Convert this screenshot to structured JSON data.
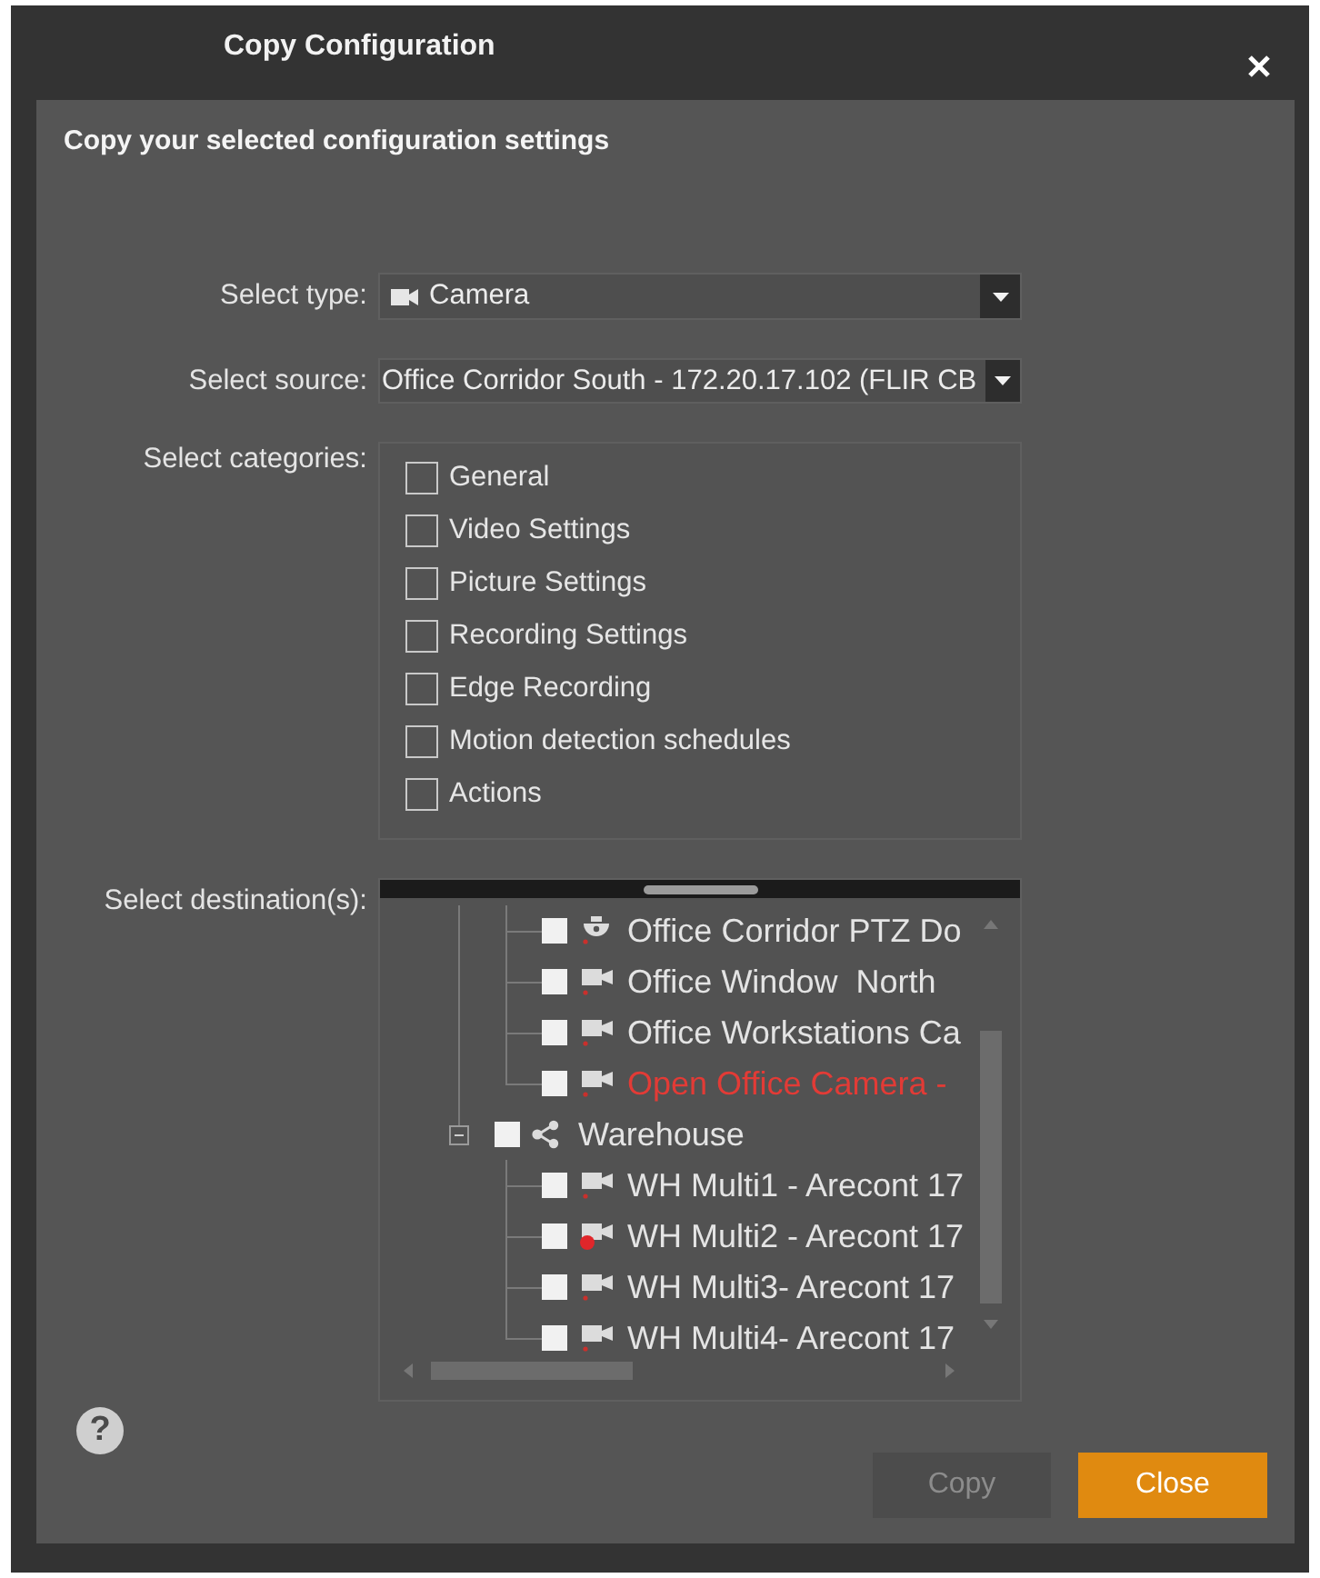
{
  "window": {
    "title": "Copy Configuration"
  },
  "heading": "Copy your selected configuration settings",
  "type_select": {
    "label": "Select type:",
    "value": "Camera"
  },
  "source_select": {
    "label": "Select source:",
    "value": "Office Corridor South - 172.20.17.102 (FLIR CB"
  },
  "categories": {
    "label": "Select categories:",
    "items": [
      {
        "label": "General",
        "checked": false
      },
      {
        "label": "Video Settings",
        "checked": false
      },
      {
        "label": "Picture Settings",
        "checked": false
      },
      {
        "label": "Recording Settings",
        "checked": false
      },
      {
        "label": "Edge Recording",
        "checked": false
      },
      {
        "label": "Motion detection schedules",
        "checked": false
      },
      {
        "label": "Actions",
        "checked": false
      }
    ]
  },
  "destinations": {
    "label": "Select destination(s):",
    "items": [
      {
        "children": [
          {
            "kind": "ptz",
            "label": "Office Corridor PTZ Do",
            "checked": false,
            "alert": false,
            "fault": false
          },
          {
            "kind": "camera",
            "label": "Office Window  North",
            "checked": false,
            "alert": false,
            "fault": false
          },
          {
            "kind": "camera",
            "label": "Office Workstations Ca",
            "checked": false,
            "alert": false,
            "fault": false
          },
          {
            "kind": "camera",
            "label": "Open Office Camera -",
            "checked": false,
            "alert": true,
            "fault": false
          }
        ]
      },
      {
        "kind": "group",
        "label": "Warehouse",
        "expanded": true,
        "checked": false,
        "alert": false,
        "children": [
          {
            "kind": "camera",
            "label": "WH Multi1 - Arecont 17",
            "checked": false,
            "alert": false,
            "fault": false
          },
          {
            "kind": "camera",
            "label": "WH Multi2 - Arecont 17",
            "checked": false,
            "alert": false,
            "fault": true
          },
          {
            "kind": "camera",
            "label": "WH Multi3- Arecont 17",
            "checked": false,
            "alert": false,
            "fault": false
          },
          {
            "kind": "camera",
            "label": "WH Multi4- Arecont 17",
            "checked": false,
            "alert": false,
            "fault": false
          }
        ]
      }
    ]
  },
  "help": "?",
  "buttons": [
    {
      "label": "Copy",
      "disabled": true
    },
    {
      "label": "Close",
      "disabled": false
    }
  ]
}
